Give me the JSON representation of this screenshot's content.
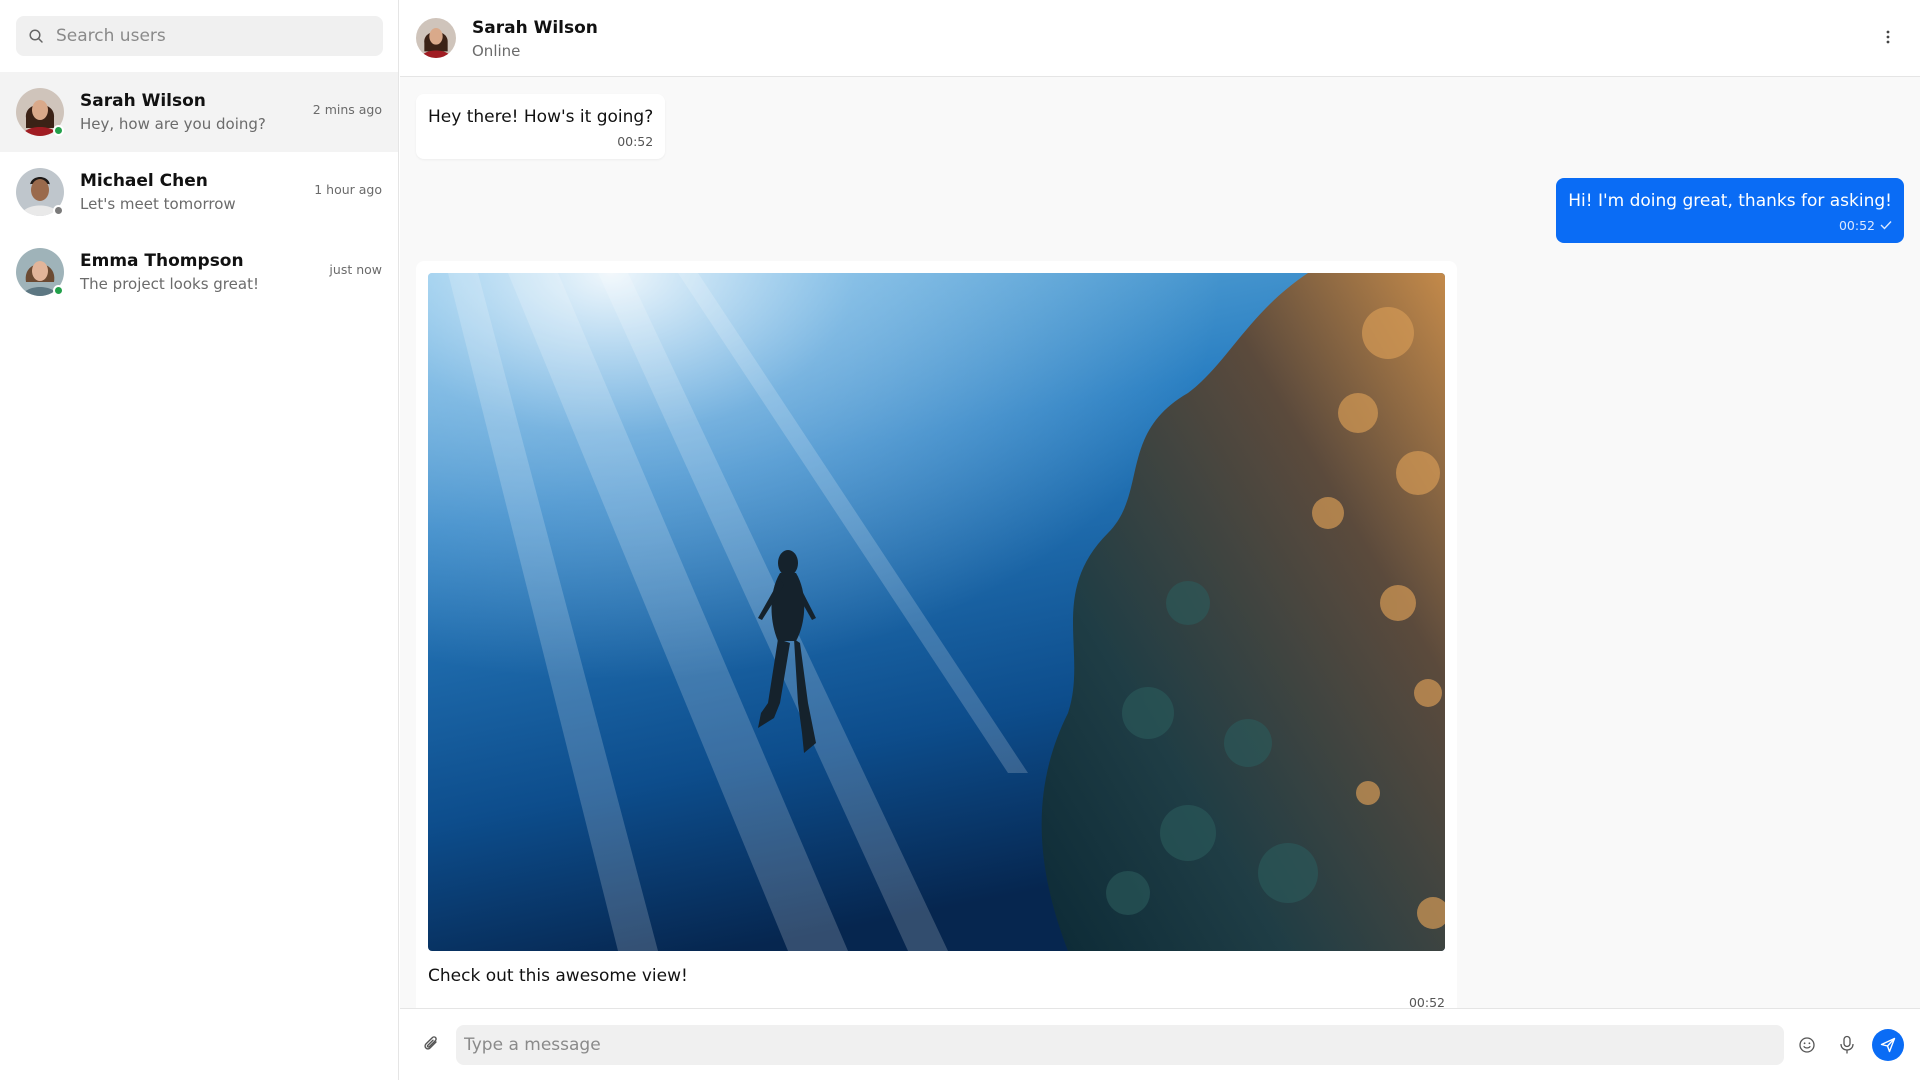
{
  "colors": {
    "accent": "#0a6cf5",
    "online": "#22a04a",
    "offline": "#7a7a7a"
  },
  "search": {
    "placeholder": "Search users",
    "icon": "search-icon"
  },
  "contacts": [
    {
      "name": "Sarah Wilson",
      "preview": "Hey, how are you doing?",
      "time": "2 mins ago",
      "status": "online",
      "active": true
    },
    {
      "name": "Michael Chen",
      "preview": "Let's meet tomorrow",
      "time": "1 hour ago",
      "status": "offline",
      "active": false
    },
    {
      "name": "Emma Thompson",
      "preview": "The project looks great!",
      "time": "just now",
      "status": "online",
      "active": false
    }
  ],
  "header": {
    "name": "Sarah Wilson",
    "status": "Online",
    "menu_icon": "more-vertical-icon"
  },
  "messages": [
    {
      "direction": "incoming",
      "text": "Hey there! How's it going?",
      "time": "00:52"
    },
    {
      "direction": "outgoing",
      "text": "Hi! I'm doing great, thanks for asking!",
      "time": "00:52",
      "read_icon": "check-icon"
    },
    {
      "direction": "incoming",
      "type": "image",
      "image_subject": "free diver underwater beside coral reef",
      "caption": "Check out this awesome view!",
      "time": "00:52"
    }
  ],
  "composer": {
    "placeholder": "Type a message",
    "attach_icon": "paperclip-icon",
    "emoji_icon": "smile-icon",
    "mic_icon": "microphone-icon",
    "send_icon": "send-icon"
  }
}
